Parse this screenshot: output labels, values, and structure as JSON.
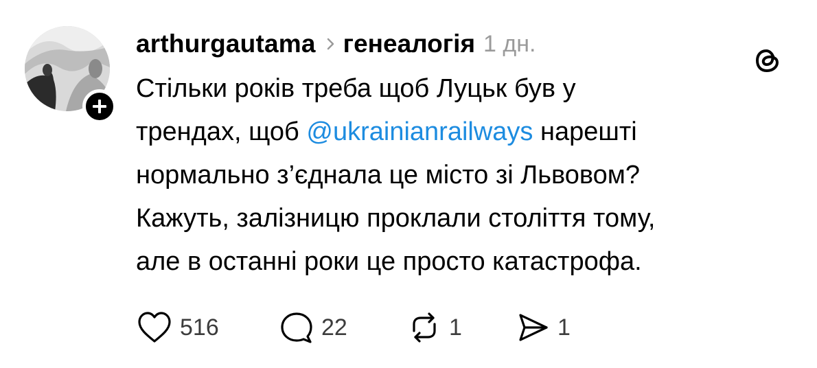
{
  "post": {
    "username": "arthurgautama",
    "topic": "генеалогія",
    "time": "1 дн.",
    "text": {
      "line1": "Стільки років треба щоб Луцьк був у",
      "line2_before": "трендах, щоб ",
      "mention": "@ukrainianrailways",
      "line2_after": " нарешті",
      "line3": "нормально з’єднала це місто зі Львовом?",
      "line4": "Кажуть, залізницю проклали століття тому,",
      "line5": "але в останні роки це просто катастрофа."
    },
    "actions": {
      "likes": "516",
      "comments": "22",
      "reposts": "1",
      "shares": "1"
    }
  },
  "icons": {
    "avatar": "avatar",
    "follow": "plus-icon",
    "chevron": "chevron-right-icon",
    "brand": "threads-logo-icon",
    "like": "heart-icon",
    "comment": "comment-icon",
    "repost": "repost-icon",
    "share": "send-icon"
  },
  "colors": {
    "mention": "#1d8ce0",
    "time": "#9a9a9a",
    "counts": "#3c3c3c"
  }
}
